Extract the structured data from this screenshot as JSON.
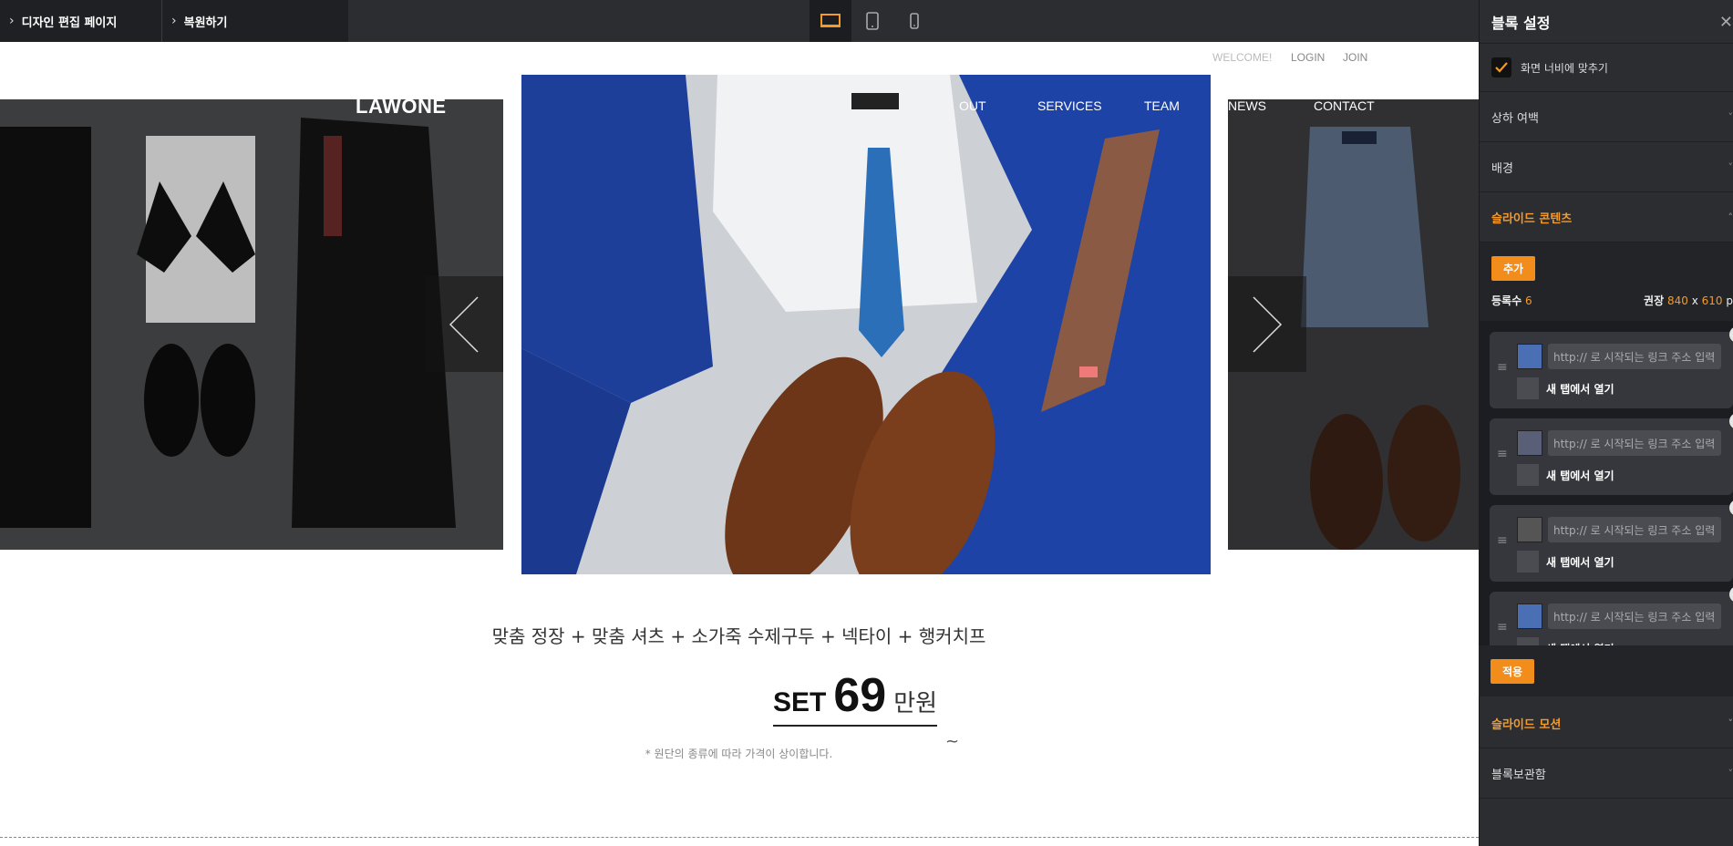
{
  "topbar": {
    "design_label": "디자인 편집 페이지",
    "restore_label": "복원하기",
    "devices": [
      "desktop-icon",
      "tablet-icon",
      "mobile-icon"
    ],
    "active_device": "desktop"
  },
  "site": {
    "util": {
      "welcome": "WELCOME!",
      "login": "LOGIN",
      "join": "JOIN"
    },
    "logo": "LAWONE",
    "nav": [
      "OUT",
      "SERVICES",
      "TEAM",
      "NEWS",
      "CONTACT"
    ],
    "headline": "맞춤 정장 + 맞춤 셔츠 + 소가죽 수제구두 + 넥타이 + 행커치프",
    "price": {
      "prefix": "SET",
      "number": "69",
      "unit": "만원",
      "suffix": "~"
    },
    "note": "* 원단의 종류에 따라 가격이 상이합니다."
  },
  "panel": {
    "title": "블록 설정",
    "fit_width_label": "화면 너비에 맞추기",
    "fit_width_checked": true,
    "sections": {
      "padding": "상하 여백",
      "background": "배경",
      "slide_content": "슬라이드 콘텐츠",
      "slide_motion": "슬라이드 모션",
      "block_store": "블록보관함"
    },
    "add_label": "추가",
    "count_label": "등록수",
    "count_value": "6",
    "recommend_label": "권장",
    "recommend_w": "840",
    "recommend_x": "x",
    "recommend_h": "610",
    "recommend_unit": "p",
    "url_placeholder": "http:// 로 시작되는 링크 주소 입력",
    "new_tab_label": "새 탭에서 열기",
    "apply_label": "적용"
  },
  "colors": {
    "accent": "#f28c1b",
    "panel_bg": "#2b2d31",
    "topbar_bg": "#2b2d31"
  }
}
